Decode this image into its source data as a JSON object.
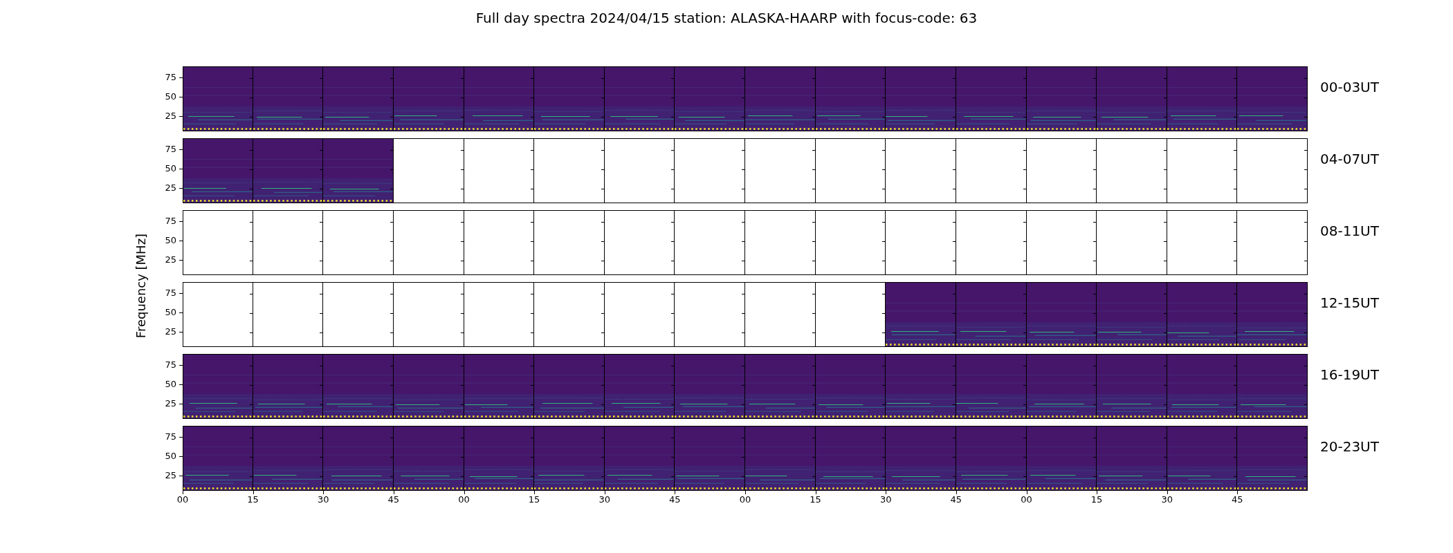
{
  "title": "Full day spectra 2024/04/15 station: ALASKA-HAARP with focus-code: 63",
  "y_axis": {
    "label": "Frequency [MHz]"
  },
  "rows": [
    {
      "label": "00-03UT",
      "yticks": [
        "75",
        "50",
        "25"
      ],
      "panels": [
        {
          "has_data": true
        },
        {
          "has_data": true
        },
        {
          "has_data": true
        },
        {
          "has_data": true
        },
        {
          "has_data": true
        },
        {
          "has_data": true
        },
        {
          "has_data": true
        },
        {
          "has_data": true
        },
        {
          "has_data": true
        },
        {
          "has_data": true
        },
        {
          "has_data": true
        },
        {
          "has_data": true
        },
        {
          "has_data": true
        },
        {
          "has_data": true
        },
        {
          "has_data": true
        },
        {
          "has_data": true
        }
      ]
    },
    {
      "label": "04-07UT",
      "yticks": [
        "75",
        "50",
        "25"
      ],
      "panels": [
        {
          "has_data": true
        },
        {
          "has_data": true
        },
        {
          "has_data": true
        },
        {
          "has_data": false
        },
        {
          "has_data": false
        },
        {
          "has_data": false
        },
        {
          "has_data": false
        },
        {
          "has_data": false
        },
        {
          "has_data": false
        },
        {
          "has_data": false
        },
        {
          "has_data": false
        },
        {
          "has_data": false
        },
        {
          "has_data": false
        },
        {
          "has_data": false
        },
        {
          "has_data": false
        },
        {
          "has_data": false
        }
      ]
    },
    {
      "label": "08-11UT",
      "yticks": [
        "75",
        "50",
        "25"
      ],
      "panels": [
        {
          "has_data": false
        },
        {
          "has_data": false
        },
        {
          "has_data": false
        },
        {
          "has_data": false
        },
        {
          "has_data": false
        },
        {
          "has_data": false
        },
        {
          "has_data": false
        },
        {
          "has_data": false
        },
        {
          "has_data": false
        },
        {
          "has_data": false
        },
        {
          "has_data": false
        },
        {
          "has_data": false
        },
        {
          "has_data": false
        },
        {
          "has_data": false
        },
        {
          "has_data": false
        },
        {
          "has_data": false
        }
      ]
    },
    {
      "label": "12-15UT",
      "yticks": [
        "75",
        "50",
        "25"
      ],
      "panels": [
        {
          "has_data": false
        },
        {
          "has_data": false
        },
        {
          "has_data": false
        },
        {
          "has_data": false
        },
        {
          "has_data": false
        },
        {
          "has_data": false
        },
        {
          "has_data": false
        },
        {
          "has_data": false
        },
        {
          "has_data": false
        },
        {
          "has_data": false
        },
        {
          "has_data": true
        },
        {
          "has_data": true
        },
        {
          "has_data": true
        },
        {
          "has_data": true
        },
        {
          "has_data": true
        },
        {
          "has_data": true
        }
      ]
    },
    {
      "label": "16-19UT",
      "yticks": [
        "75",
        "50",
        "25"
      ],
      "panels": [
        {
          "has_data": true
        },
        {
          "has_data": true
        },
        {
          "has_data": true
        },
        {
          "has_data": true
        },
        {
          "has_data": true
        },
        {
          "has_data": true
        },
        {
          "has_data": true
        },
        {
          "has_data": true
        },
        {
          "has_data": true
        },
        {
          "has_data": true
        },
        {
          "has_data": true
        },
        {
          "has_data": true
        },
        {
          "has_data": true
        },
        {
          "has_data": true
        },
        {
          "has_data": true
        },
        {
          "has_data": true
        }
      ]
    },
    {
      "label": "20-23UT",
      "yticks": [
        "75",
        "50",
        "25"
      ],
      "panels": [
        {
          "has_data": true
        },
        {
          "has_data": true
        },
        {
          "has_data": true
        },
        {
          "has_data": true
        },
        {
          "has_data": true
        },
        {
          "has_data": true
        },
        {
          "has_data": true
        },
        {
          "has_data": true
        },
        {
          "has_data": true
        },
        {
          "has_data": true
        },
        {
          "has_data": true
        },
        {
          "has_data": true
        },
        {
          "has_data": true
        },
        {
          "has_data": true
        },
        {
          "has_data": true
        },
        {
          "has_data": true
        }
      ]
    }
  ],
  "x_ticks": [
    "00",
    "15",
    "30",
    "45",
    "00",
    "15",
    "30",
    "45",
    "00",
    "15",
    "30",
    "45",
    "00",
    "15",
    "30",
    "45"
  ]
}
